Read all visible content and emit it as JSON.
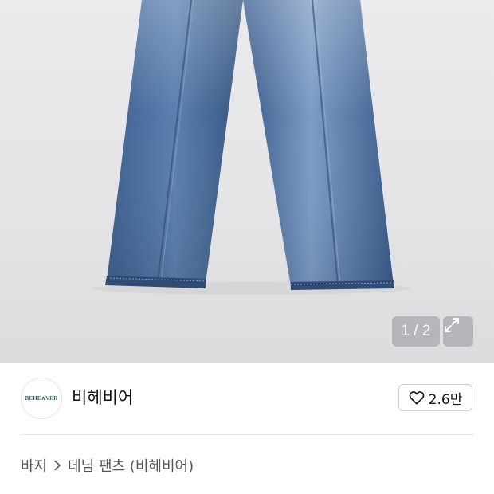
{
  "gallery": {
    "counter": "1 / 2",
    "expand_icon": "expand-icon"
  },
  "seller": {
    "avatar_text": "BEHE∧VER",
    "name": "비헤비어",
    "like_icon": "heart-icon",
    "like_count": "2.6만"
  },
  "breadcrumb": {
    "category": "바지",
    "separator_icon": "chevron-right-icon",
    "subcategory": "데님 팬츠 (비헤비어)"
  },
  "colors": {
    "denim": "#4a6d9a",
    "background": "#e8e8ea",
    "text_primary": "#111111",
    "text_secondary": "#555555"
  }
}
